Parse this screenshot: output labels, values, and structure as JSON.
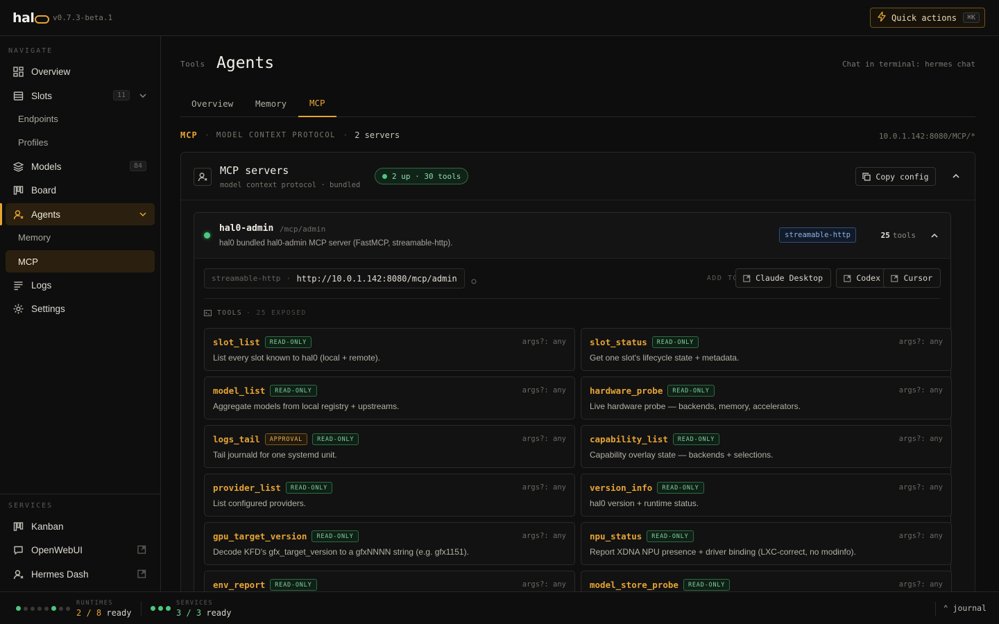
{
  "app": {
    "logo_text": "hal",
    "version": "v0.7.3-beta.1"
  },
  "quick_actions": {
    "label": "Quick actions",
    "shortcut": "⌘K"
  },
  "sidebar": {
    "navigate_label": "NAVIGATE",
    "overview": "Overview",
    "slots": "Slots",
    "slots_count": "11",
    "endpoints": "Endpoints",
    "profiles": "Profiles",
    "models": "Models",
    "models_count": "84",
    "board": "Board",
    "agents": "Agents",
    "memory": "Memory",
    "mcp": "MCP",
    "logs": "Logs",
    "settings": "Settings",
    "services_label": "SERVICES",
    "kanban": "Kanban",
    "openwebui": "OpenWebUI",
    "hermes_dash": "Hermes Dash"
  },
  "header": {
    "crumb": "Tools",
    "title": "Agents",
    "terminal_hint": "Chat in terminal: hermes chat"
  },
  "tabs": {
    "overview": "Overview",
    "memory": "Memory",
    "mcp": "MCP"
  },
  "mcp_line": {
    "tag": "MCP",
    "sep": "·",
    "protocol": "MODEL CONTEXT PROTOCOL",
    "servers": "2 servers",
    "url": "10.0.1.142:8080/MCP/*"
  },
  "panel": {
    "title": "MCP servers",
    "subtitle": "model context protocol · bundled",
    "status": "2 up · 30 tools",
    "copy_config": "Copy config"
  },
  "server": {
    "name": "hal0-admin",
    "path": "/mcp/admin",
    "description": "hal0 bundled hal0-admin MCP server (FastMCP, streamable-http).",
    "transport": "streamable-http",
    "tool_count": "25",
    "tool_count_label": "tools",
    "endpoint_transport": "streamable-http",
    "endpoint_sep": "·",
    "endpoint_url": "http://10.0.1.142:8080/mcp/admin",
    "add_to": "ADD TO",
    "clients": {
      "claude": "Claude Desktop",
      "codex": "Codex",
      "cursor": "Cursor"
    },
    "tools_label": "TOOLS",
    "tools_exposed": "· 25 EXPOSED"
  },
  "tools": [
    {
      "name": "slot_list",
      "badges": [
        "READ-ONLY"
      ],
      "args": "args?: any",
      "desc": "List every slot known to hal0 (local + remote)."
    },
    {
      "name": "slot_status",
      "badges": [
        "READ-ONLY"
      ],
      "args": "args?: any",
      "desc": "Get one slot's lifecycle state + metadata."
    },
    {
      "name": "model_list",
      "badges": [
        "READ-ONLY"
      ],
      "args": "args?: any",
      "desc": "Aggregate models from local registry + upstreams."
    },
    {
      "name": "hardware_probe",
      "badges": [
        "READ-ONLY"
      ],
      "args": "args?: any",
      "desc": "Live hardware probe — backends, memory, accelerators."
    },
    {
      "name": "logs_tail",
      "badges": [
        "APPROVAL",
        "READ-ONLY"
      ],
      "args": "args?: any",
      "desc": "Tail journald for one systemd unit."
    },
    {
      "name": "capability_list",
      "badges": [
        "READ-ONLY"
      ],
      "args": "args?: any",
      "desc": "Capability overlay state — backends + selections."
    },
    {
      "name": "provider_list",
      "badges": [
        "READ-ONLY"
      ],
      "args": "args?: any",
      "desc": "List configured providers."
    },
    {
      "name": "version_info",
      "badges": [
        "READ-ONLY"
      ],
      "args": "args?: any",
      "desc": "hal0 version + runtime status."
    },
    {
      "name": "gpu_target_version",
      "badges": [
        "READ-ONLY"
      ],
      "args": "args?: any",
      "desc": "Decode KFD's gfx_target_version to a gfxNNNN string (e.g. gfx1151)."
    },
    {
      "name": "npu_status",
      "badges": [
        "READ-ONLY"
      ],
      "args": "args?: any",
      "desc": "Report XDNA NPU presence + driver binding (LXC-correct, no modinfo)."
    },
    {
      "name": "env_report",
      "badges": [
        "READ-ONLY"
      ],
      "args": "args?: any",
      "desc": ""
    },
    {
      "name": "model_store_probe",
      "badges": [
        "READ-ONLY"
      ],
      "args": "args?: any",
      "desc": ""
    }
  ],
  "footer": {
    "runtimes_label": "RUNTIMES",
    "runtimes_ready": "2 / 8",
    "runtimes_suffix": "ready",
    "runtimes_on": 2,
    "runtimes_total": 8,
    "services_label": "SERVICES",
    "services_ready": "3 / 3",
    "services_suffix": "ready",
    "journal": "⌃ journal"
  },
  "colors": {
    "accent": "#e6a435",
    "ok": "#4cc77d",
    "bg": "#0d0d0d"
  }
}
